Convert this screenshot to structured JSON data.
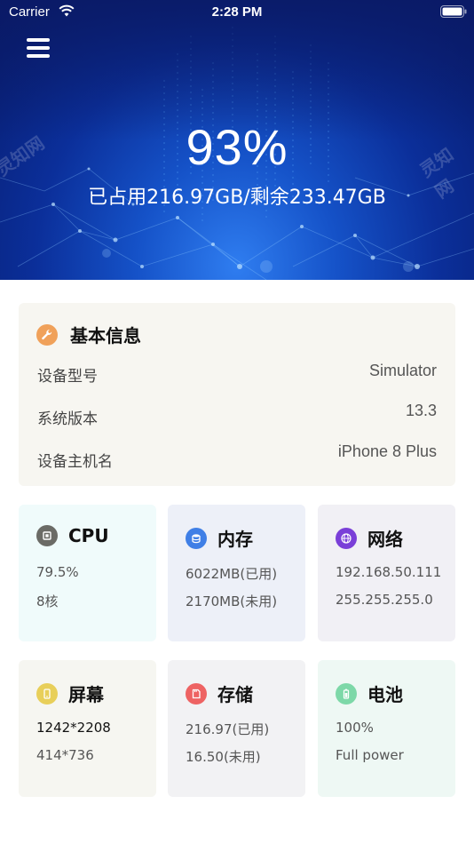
{
  "status_bar": {
    "carrier": "Carrier",
    "time": "2:28 PM"
  },
  "hero": {
    "percent": "93%",
    "usage": "已占用216.97GB/剩余233.47GB",
    "watermark": "灵知网"
  },
  "basic_info": {
    "title": "基本信息",
    "rows": [
      {
        "label": "设备型号",
        "value": "Simulator"
      },
      {
        "label": "系统版本",
        "value": "13.3"
      },
      {
        "label": "设备主机名",
        "value": "iPhone 8 Plus"
      }
    ]
  },
  "tiles": [
    {
      "title": "CPU",
      "line1": "79.5%",
      "line2": "8核",
      "icon": "cpu-icon",
      "bg": "#f0fbfb",
      "icon_color": "#6b6b66"
    },
    {
      "title": "内存",
      "line1": "6022MB(已用)",
      "line2": "2170MB(未用)",
      "icon": "memory-icon",
      "bg": "#edf0f8",
      "icon_color": "#3f7fe6"
    },
    {
      "title": "网络",
      "line1": "192.168.50.111",
      "line2": "255.255.255.0",
      "icon": "network-icon",
      "bg": "#f1f0f5",
      "icon_color": "#7a3fd8"
    },
    {
      "title": "屏幕",
      "line1": "1242*2208",
      "line2": "414*736",
      "icon": "screen-icon",
      "bg": "#f6f6f1",
      "icon_color": "#e8cf5a"
    },
    {
      "title": "存储",
      "line1": "216.97(已用)",
      "line2": "16.50(未用)",
      "icon": "storage-icon",
      "bg": "#f2f2f4",
      "icon_color": "#ee6363"
    },
    {
      "title": "电池",
      "line1": "100%",
      "line2": "Full power",
      "icon": "battery-icon",
      "bg": "#eef8f4",
      "icon_color": "#7dd8a8"
    }
  ],
  "colors": {
    "accent_info": "#f0a15a",
    "hero_dark": "#071a6a",
    "hero_light": "#2f7df0"
  }
}
